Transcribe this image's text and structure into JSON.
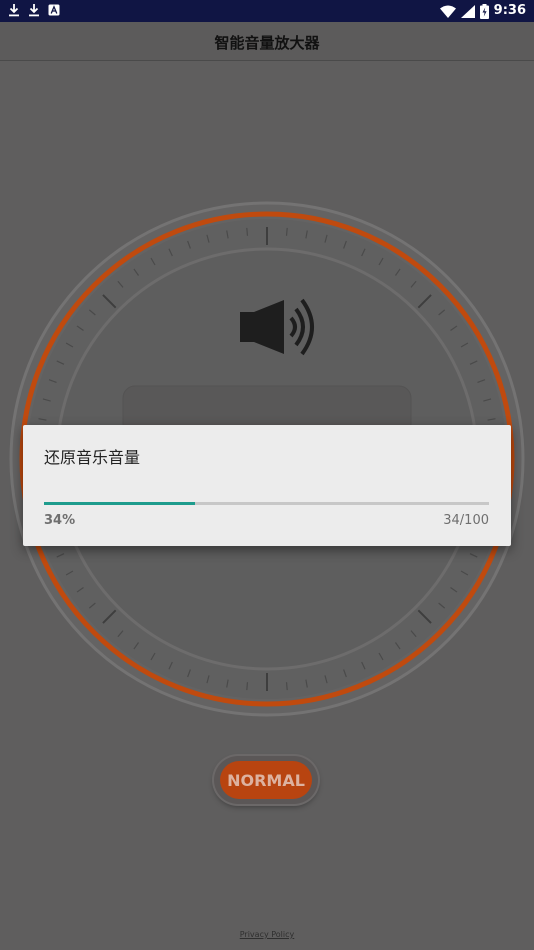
{
  "status_bar": {
    "time": "9:36",
    "icons": [
      "download-icon",
      "download-icon",
      "notification-a-icon",
      "wifi-icon",
      "signal-icon",
      "battery-icon"
    ]
  },
  "app": {
    "title": "智能音量放大器",
    "mode_button": "NORMAL",
    "privacy_link": "Privacy Policy",
    "accent_color": "#c04a0e"
  },
  "dialog": {
    "title": "还原音乐音量",
    "percent_text": "34%",
    "count_text": "34/100",
    "progress": 0.34,
    "progress_color": "#1e9c8d"
  }
}
